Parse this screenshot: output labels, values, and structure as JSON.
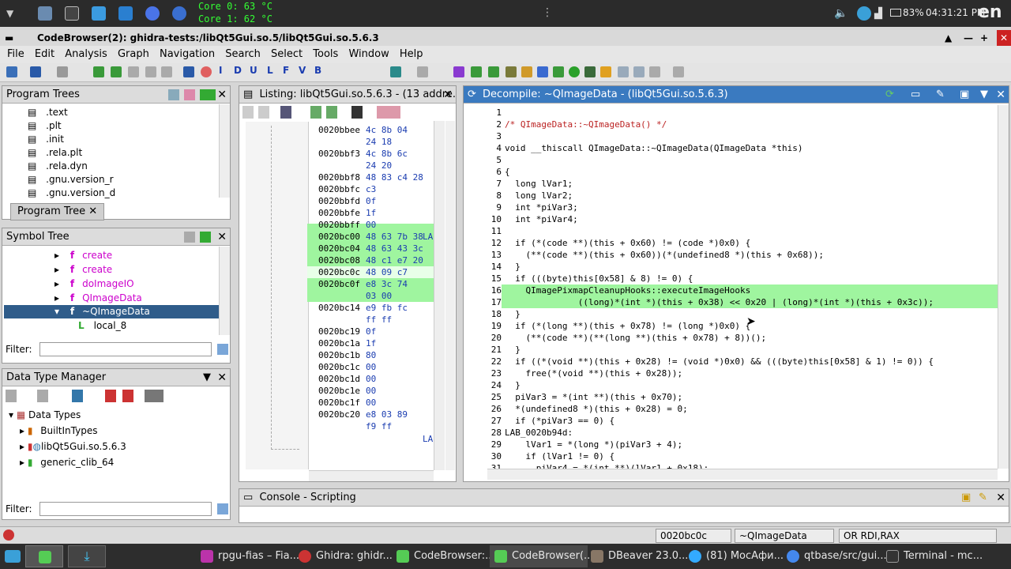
{
  "system": {
    "core0": "Core 0: 63 °C",
    "core1": "Core 1: 62 °C",
    "battery": "83%",
    "clock": "04:31:21 PM",
    "lang": "en",
    "dots": "⋮"
  },
  "window": {
    "title": "CodeBrowser(2): ghidra-tests:/libQt5Gui.so.5/libQt5Gui.so.5.6.3"
  },
  "menu": [
    "File",
    "Edit",
    "Analysis",
    "Graph",
    "Navigation",
    "Search",
    "Select",
    "Tools",
    "Window",
    "Help"
  ],
  "program_trees": {
    "title": "Program Trees",
    "items": [
      ".text",
      ".plt",
      ".init",
      ".rela.plt",
      ".rela.dyn",
      ".gnu.version_r",
      ".gnu.version_d"
    ],
    "tab": "Program Tree"
  },
  "symbol_tree": {
    "title": "Symbol Tree",
    "items": [
      {
        "label": "create",
        "kind": "f"
      },
      {
        "label": "create",
        "kind": "f"
      },
      {
        "label": "doImageIO",
        "kind": "f"
      },
      {
        "label": "QImageData",
        "kind": "f"
      },
      {
        "label": "~QImageData",
        "kind": "f"
      },
      {
        "label": "local_8",
        "kind": "L"
      }
    ],
    "filter_label": "Filter:"
  },
  "data_type_manager": {
    "title": "Data Type Manager",
    "root": "Data Types",
    "items": [
      "BuiltInTypes",
      "libQt5Gui.so.5.6.3",
      "generic_clib_64"
    ],
    "filter_label": "Filter:"
  },
  "listing": {
    "title": "Listing:  libQt5Gui.so.5.6.3 - (13 addre...",
    "label_lab": "LA",
    "rows": [
      {
        "addr": "0020bbee",
        "bytes": "4c 8b 04",
        "hl": false
      },
      {
        "addr": "",
        "bytes": "24 18",
        "hl": false
      },
      {
        "addr": "0020bbf3",
        "bytes": "4c 8b 6c",
        "hl": false
      },
      {
        "addr": "",
        "bytes": "24 20",
        "hl": false
      },
      {
        "addr": "0020bbf8",
        "bytes": "48 83 c4 28",
        "hl": false
      },
      {
        "addr": "0020bbfc",
        "bytes": "c3",
        "hl": false
      },
      {
        "addr": "0020bbfd",
        "bytes": "0f",
        "hl": false
      },
      {
        "addr": "0020bbfe",
        "bytes": "1f",
        "hl": false
      },
      {
        "addr": "0020bbff",
        "bytes": "00",
        "hl": false
      },
      {
        "addr": "0020bc00",
        "bytes": "48 63 7b 38",
        "hl": true
      },
      {
        "addr": "0020bc04",
        "bytes": "48 63 43 3c",
        "hl": true
      },
      {
        "addr": "0020bc08",
        "bytes": "48 c1 e7 20",
        "hl": true
      },
      {
        "addr": "0020bc0c",
        "bytes": "48 09 c7",
        "hl": "cur"
      },
      {
        "addr": "0020bc0f",
        "bytes": "e8 3c 74",
        "hl": true
      },
      {
        "addr": "",
        "bytes": "03 00",
        "hl": true
      },
      {
        "addr": "0020bc14",
        "bytes": "e9 fb fc",
        "hl": false
      },
      {
        "addr": "",
        "bytes": "ff ff",
        "hl": false
      },
      {
        "addr": "0020bc19",
        "bytes": "0f",
        "hl": false
      },
      {
        "addr": "0020bc1a",
        "bytes": "1f",
        "hl": false
      },
      {
        "addr": "0020bc1b",
        "bytes": "80",
        "hl": false
      },
      {
        "addr": "0020bc1c",
        "bytes": "00",
        "hl": false
      },
      {
        "addr": "0020bc1d",
        "bytes": "00",
        "hl": false
      },
      {
        "addr": "0020bc1e",
        "bytes": "00",
        "hl": false
      },
      {
        "addr": "0020bc1f",
        "bytes": "00",
        "hl": false
      },
      {
        "addr": "0020bc20",
        "bytes": "e8 03 89",
        "hl": false
      },
      {
        "addr": "",
        "bytes": "f9 ff",
        "hl": false
      }
    ]
  },
  "decompile": {
    "title": "Decompile: ~QImageData -  (libQt5Gui.so.5.6.3)",
    "lines": [
      "",
      "/* QImageData::~QImageData() */",
      "",
      "void __thiscall QImageData::~QImageData(QImageData *this)",
      "",
      "{",
      "  long lVar1;",
      "  long lVar2;",
      "  int *piVar3;",
      "  int *piVar4;",
      "",
      "  if (*(code **)(this + 0x60) != (code *)0x0) {",
      "    (**(code **)(this + 0x60))(*(undefined8 *)(this + 0x68));",
      "  }",
      "  if (((byte)this[0x58] & 8) != 0) {",
      "    QImagePixmapCleanupHooks::executeImageHooks",
      "              ((long)*(int *)(this + 0x38) << 0x20 | (long)*(int *)(this + 0x3c));",
      "  }",
      "  if (*(long **)(this + 0x78) != (long *)0x0) {",
      "    (**(code **)(**(long **)(this + 0x78) + 8))();",
      "  }",
      "  if ((*(void **)(this + 0x28) != (void *)0x0) && (((byte)this[0x58] & 1) != 0)) {",
      "    free(*(void **)(this + 0x28));",
      "  }",
      "  piVar3 = *(int **)(this + 0x70);",
      "  *(undefined8 *)(this + 0x28) = 0;",
      "  if (*piVar3 == 0) {",
      "LAB_0020b94d:",
      "    lVar1 = *(long *)(piVar3 + 4);",
      "    if (lVar1 != 0) {",
      "      piVar4 = *(int **)(lVar1 + 0x18);"
    ]
  },
  "console": {
    "title": "Console - Scripting"
  },
  "status": {
    "address": "0020bc0c",
    "function": "~QImageData",
    "instruction": "OR RDI,RAX"
  },
  "taskbar": {
    "items": [
      "rpgu-fias – Fia...",
      "Ghidra: ghidr...",
      "CodeBrowser:...",
      "CodeBrowser(...",
      "DBeaver 23.0...",
      "(81) МосАфи...",
      "qtbase/src/gui...",
      "Terminal - mc..."
    ]
  }
}
